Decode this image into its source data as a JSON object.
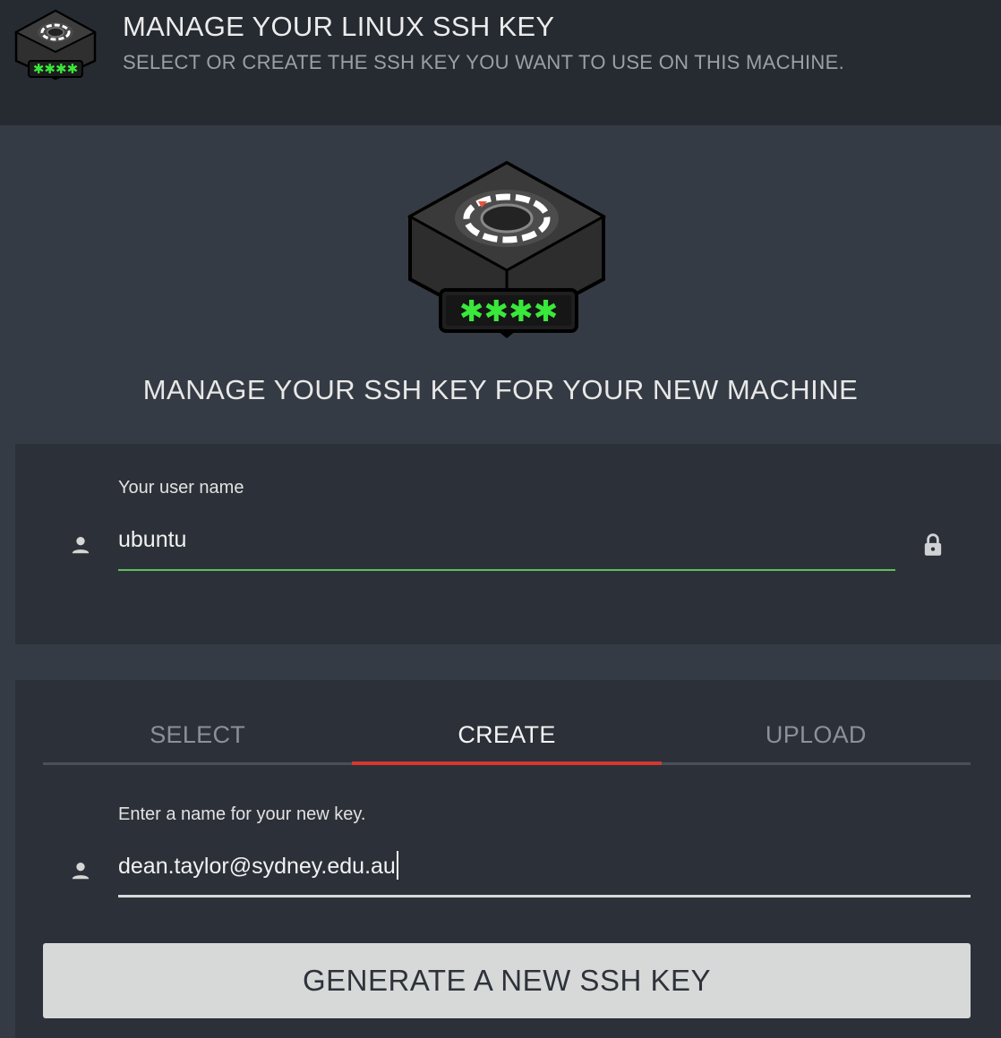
{
  "header": {
    "title": "MANAGE YOUR LINUX SSH KEY",
    "subtitle": "SELECT OR CREATE THE SSH KEY YOU WANT TO USE ON THIS MACHINE.",
    "logo_icon": "ssh-key-box-icon"
  },
  "main": {
    "title": "MANAGE YOUR SSH KEY FOR YOUR NEW MACHINE"
  },
  "user_card": {
    "label": "Your user name",
    "value": "ubuntu",
    "leading_icon": "person-icon",
    "trailing_icon": "lock-icon"
  },
  "key_card": {
    "tabs": [
      {
        "label": "SELECT",
        "active": false
      },
      {
        "label": "CREATE",
        "active": true
      },
      {
        "label": "UPLOAD",
        "active": false
      }
    ],
    "name_label": "Enter a name for your new key.",
    "name_value": "dean.taylor@sydney.edu.au",
    "name_icon": "person-icon",
    "button_label": "GENERATE A NEW SSH KEY"
  },
  "colors": {
    "accent": "#d8372f",
    "field_valid": "#5fbf5c",
    "key_glow": "#39e83a",
    "background": "#353b44",
    "card": "#2c3139",
    "header": "#262b32"
  }
}
